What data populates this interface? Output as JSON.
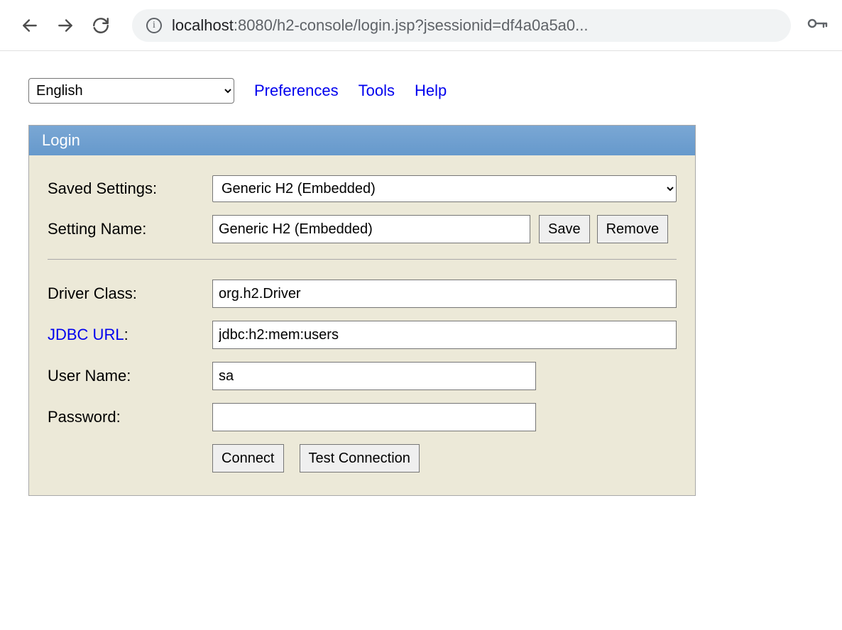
{
  "browser": {
    "url_prefix": "localhost",
    "url_rest": ":8080/h2-console/login.jsp?jsessionid=df4a0a5a0..."
  },
  "top": {
    "language": "English",
    "links": {
      "preferences": "Preferences",
      "tools": "Tools",
      "help": "Help"
    }
  },
  "panel": {
    "title": "Login",
    "labels": {
      "saved_settings": "Saved Settings:",
      "setting_name": "Setting Name:",
      "driver_class": "Driver Class:",
      "jdbc_url_link": "JDBC URL",
      "jdbc_url_colon": ":",
      "user_name": "User Name:",
      "password": "Password:"
    },
    "values": {
      "saved_settings": "Generic H2 (Embedded)",
      "setting_name": "Generic H2 (Embedded)",
      "driver_class": "org.h2.Driver",
      "jdbc_url": "jdbc:h2:mem:users",
      "user_name": "sa",
      "password": ""
    },
    "buttons": {
      "save": "Save",
      "remove": "Remove",
      "connect": "Connect",
      "test": "Test Connection"
    }
  }
}
